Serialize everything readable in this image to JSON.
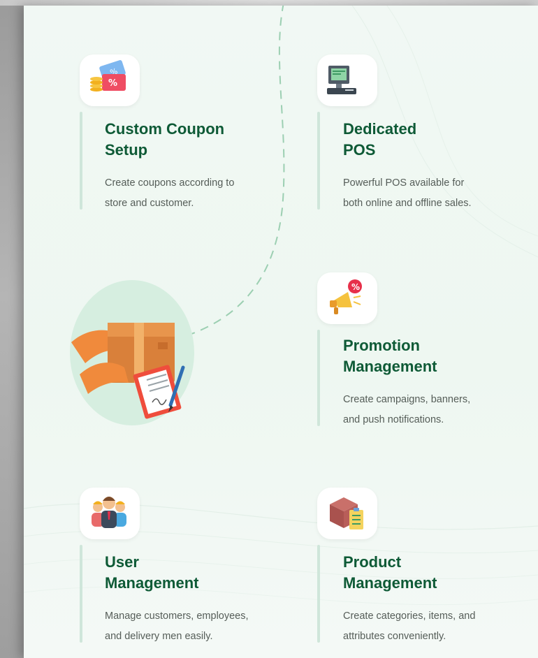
{
  "features": [
    {
      "title_line1": "Custom Coupon",
      "title_line2": "Setup",
      "desc_line1": "Create coupons according to",
      "desc_line2": "store and customer.",
      "icon": "coupon-icon"
    },
    {
      "title_line1": "Dedicated",
      "title_line2": "POS",
      "desc_line1": "Powerful POS available for",
      "desc_line2": "both online and offline sales.",
      "icon": "pos-terminal-icon"
    },
    {
      "title_line1": "Promotion",
      "title_line2": "Management",
      "desc_line1": "Create campaigns, banners,",
      "desc_line2": "and push notifications.",
      "icon": "megaphone-icon"
    },
    {
      "title_line1": "User",
      "title_line2": "Management",
      "desc_line1": "Manage customers, employees,",
      "desc_line2": "and delivery men easily.",
      "icon": "users-group-icon"
    },
    {
      "title_line1": "Product",
      "title_line2": "Management",
      "desc_line1": "Create categories, items, and",
      "desc_line2": "attributes conveniently.",
      "icon": "product-box-icon"
    }
  ],
  "illustration": {
    "icon": "delivery-package-icon"
  },
  "colors": {
    "title": "#0e5a36",
    "desc": "#555d58",
    "accent_bar": "#cfe6da",
    "panel_bg": "#eff7f2"
  }
}
